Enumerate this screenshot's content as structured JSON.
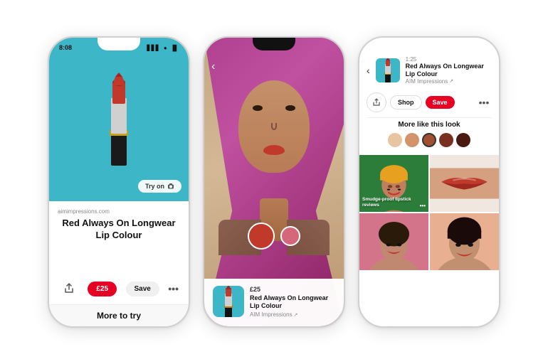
{
  "phones": [
    {
      "id": "phone1",
      "status_time": "8:08",
      "status_icons": "▋▋▋  ●  ▐▌",
      "image_bg": "#3db6c8",
      "try_on_label": "Try on",
      "domain": "aimimpressions.com",
      "product_title": "Red Always On Longwear\nLip Colour",
      "price": "£25",
      "save_label": "Save",
      "more_to_try": "More to try"
    },
    {
      "id": "phone2",
      "price_small": "£25",
      "name_small": "Red Always On Longwear\nLip Colour",
      "vendor_small": "AIM Impressions"
    },
    {
      "id": "phone3",
      "status_numbers": "1:25",
      "product_title": "Red Always On Longwear\nLip Colour",
      "vendor": "AIM Impressions",
      "shop_label": "Shop",
      "save_label": "Save",
      "more_like_title": "More like this look",
      "grid_label_1": "Smudge-proof lipstick\nreviews",
      "swatches": [
        "#e8c4a0",
        "#d4946a",
        "#a05030",
        "#7a3020",
        "#4a1a10"
      ]
    }
  ]
}
